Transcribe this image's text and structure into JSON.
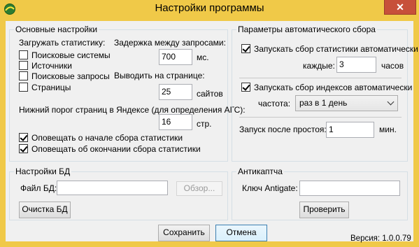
{
  "window": {
    "title": "Настройки программы",
    "close_glyph": "✕",
    "accent_color": "#f0c948",
    "close_color": "#c7503a",
    "icon": "app-logo-icon"
  },
  "basic": {
    "legend": "Основные настройки",
    "load_stats_label": "Загружать статистику:",
    "sources": [
      {
        "label": "Поисковые системы",
        "checked": false
      },
      {
        "label": "Источники",
        "checked": false
      },
      {
        "label": "Поисковые запросы",
        "checked": false
      },
      {
        "label": "Страницы",
        "checked": false
      }
    ],
    "delay_label": "Задержка между запросами:",
    "delay_value": "700",
    "delay_unit": "мс.",
    "per_page_label": "Выводить на странице:",
    "per_page_value": "25",
    "per_page_unit": "сайтов",
    "yandex_threshold_label": "Нижний порог страниц в Яндексе (для определения АГС):",
    "yandex_threshold_value": "16",
    "yandex_threshold_unit": "стр.",
    "notify_start": {
      "label": "Оповещать о начале сбора статистики",
      "checked": true
    },
    "notify_end": {
      "label": "Оповещать об окончании сбора статистики",
      "checked": true
    }
  },
  "auto": {
    "legend": "Параметры автоматического сбора",
    "stats_auto": {
      "label": "Запускать сбор статистики автоматически",
      "checked": true
    },
    "every_label": "каждые:",
    "every_value": "3",
    "every_unit": "часов",
    "index_auto": {
      "label": "Запускать сбор индексов автоматически",
      "checked": true
    },
    "frequency_label": "частота:",
    "frequency_value": "раз в 1 день",
    "idle_label": "Запуск после простоя:",
    "idle_value": "1",
    "idle_unit": "мин."
  },
  "db": {
    "legend": "Настройки БД",
    "file_label": "Файл БД:",
    "file_value": "",
    "browse_label": "Обзор...",
    "clear_label": "Очистка БД"
  },
  "captcha": {
    "legend": "Антикаптча",
    "key_label": "Ключ Antigate:",
    "key_value": "",
    "check_label": "Проверить"
  },
  "footer": {
    "save_label": "Сохранить",
    "cancel_label": "Отмена",
    "version": "Версия: 1.0.0.79"
  }
}
